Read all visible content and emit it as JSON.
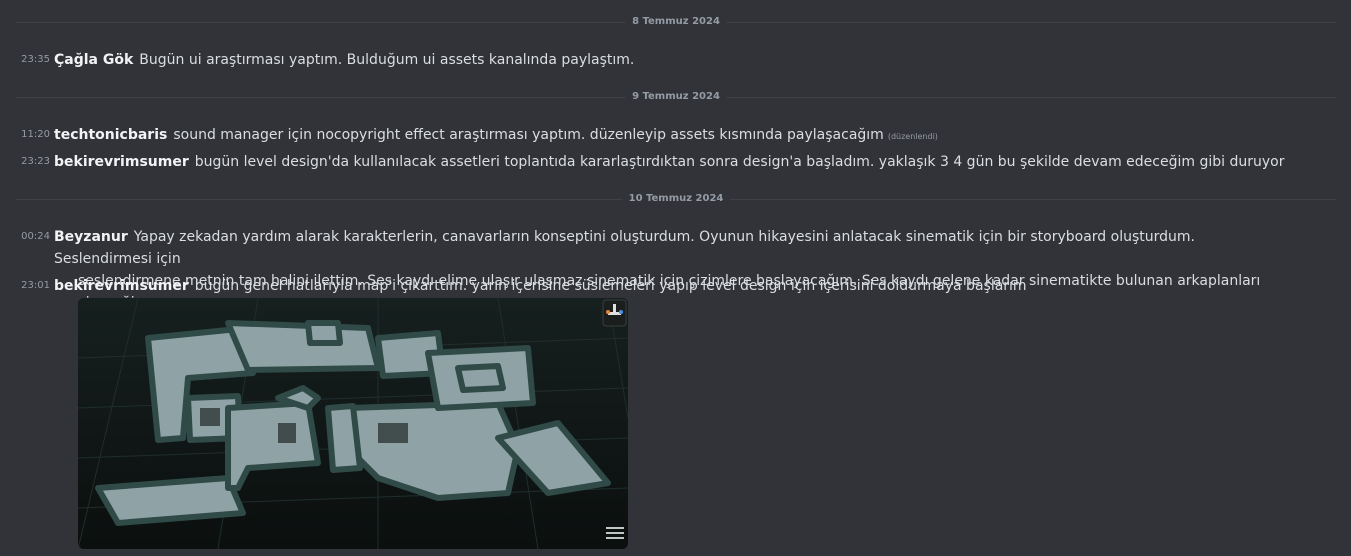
{
  "dividers": [
    {
      "label": "8 Temmuz 2024"
    },
    {
      "label": "9 Temmuz 2024"
    },
    {
      "label": "10 Temmuz 2024"
    }
  ],
  "messages": [
    {
      "time": "23:35",
      "author": "Çağla Gök",
      "text": "Bugün ui araştırması yaptım. Bulduğum ui assets kanalında paylaştım."
    },
    {
      "time": "11:20",
      "author": "techtonicbaris",
      "text": "sound manager için nocopyright effect araştırması yaptım. düzenleyip assets kısmında paylaşacağım",
      "edited": "(düzenlendi)"
    },
    {
      "time": "23:23",
      "author": "bekirevrimsumer",
      "text": "bugün level design'da kullanılacak assetleri toplantıda kararlaştırdıktan sonra design'a başladım. yaklaşık 3 4 gün bu şekilde devam edeceğim gibi duruyor"
    },
    {
      "time": "00:24",
      "author": "Beyzanur",
      "text": "Yapay zekadan yardım alarak karakterlerin, canavarların konseptini oluşturdum. Oyunun hikayesini anlatacak sinematik için bir storyboard oluşturdum. Seslendirmesi için",
      "text2": "seslendirmene metnin tam halini ilettim. Ses kaydı elime ulaşır ulaşmaz sinematik için çizimlere başlayacağım. Ses kaydı gelene kadar sinematikte bulunan arkaplanları çizeceğim."
    },
    {
      "time": "23:01",
      "author": "bekirevrimsumer",
      "text": "bugün genel hatlarıyla map'i çıkarttım. yarın içerisine süslemeleri yapıp level design için içerisini doldurmaya başlarım"
    }
  ],
  "colors": {
    "background": "#313338",
    "divider": "#3f4147",
    "muted": "#949ba4",
    "text": "#dbdee1",
    "author": "#f2f3f5",
    "map_floor": "#8fa3a6",
    "map_wall": "#2f4a47"
  }
}
